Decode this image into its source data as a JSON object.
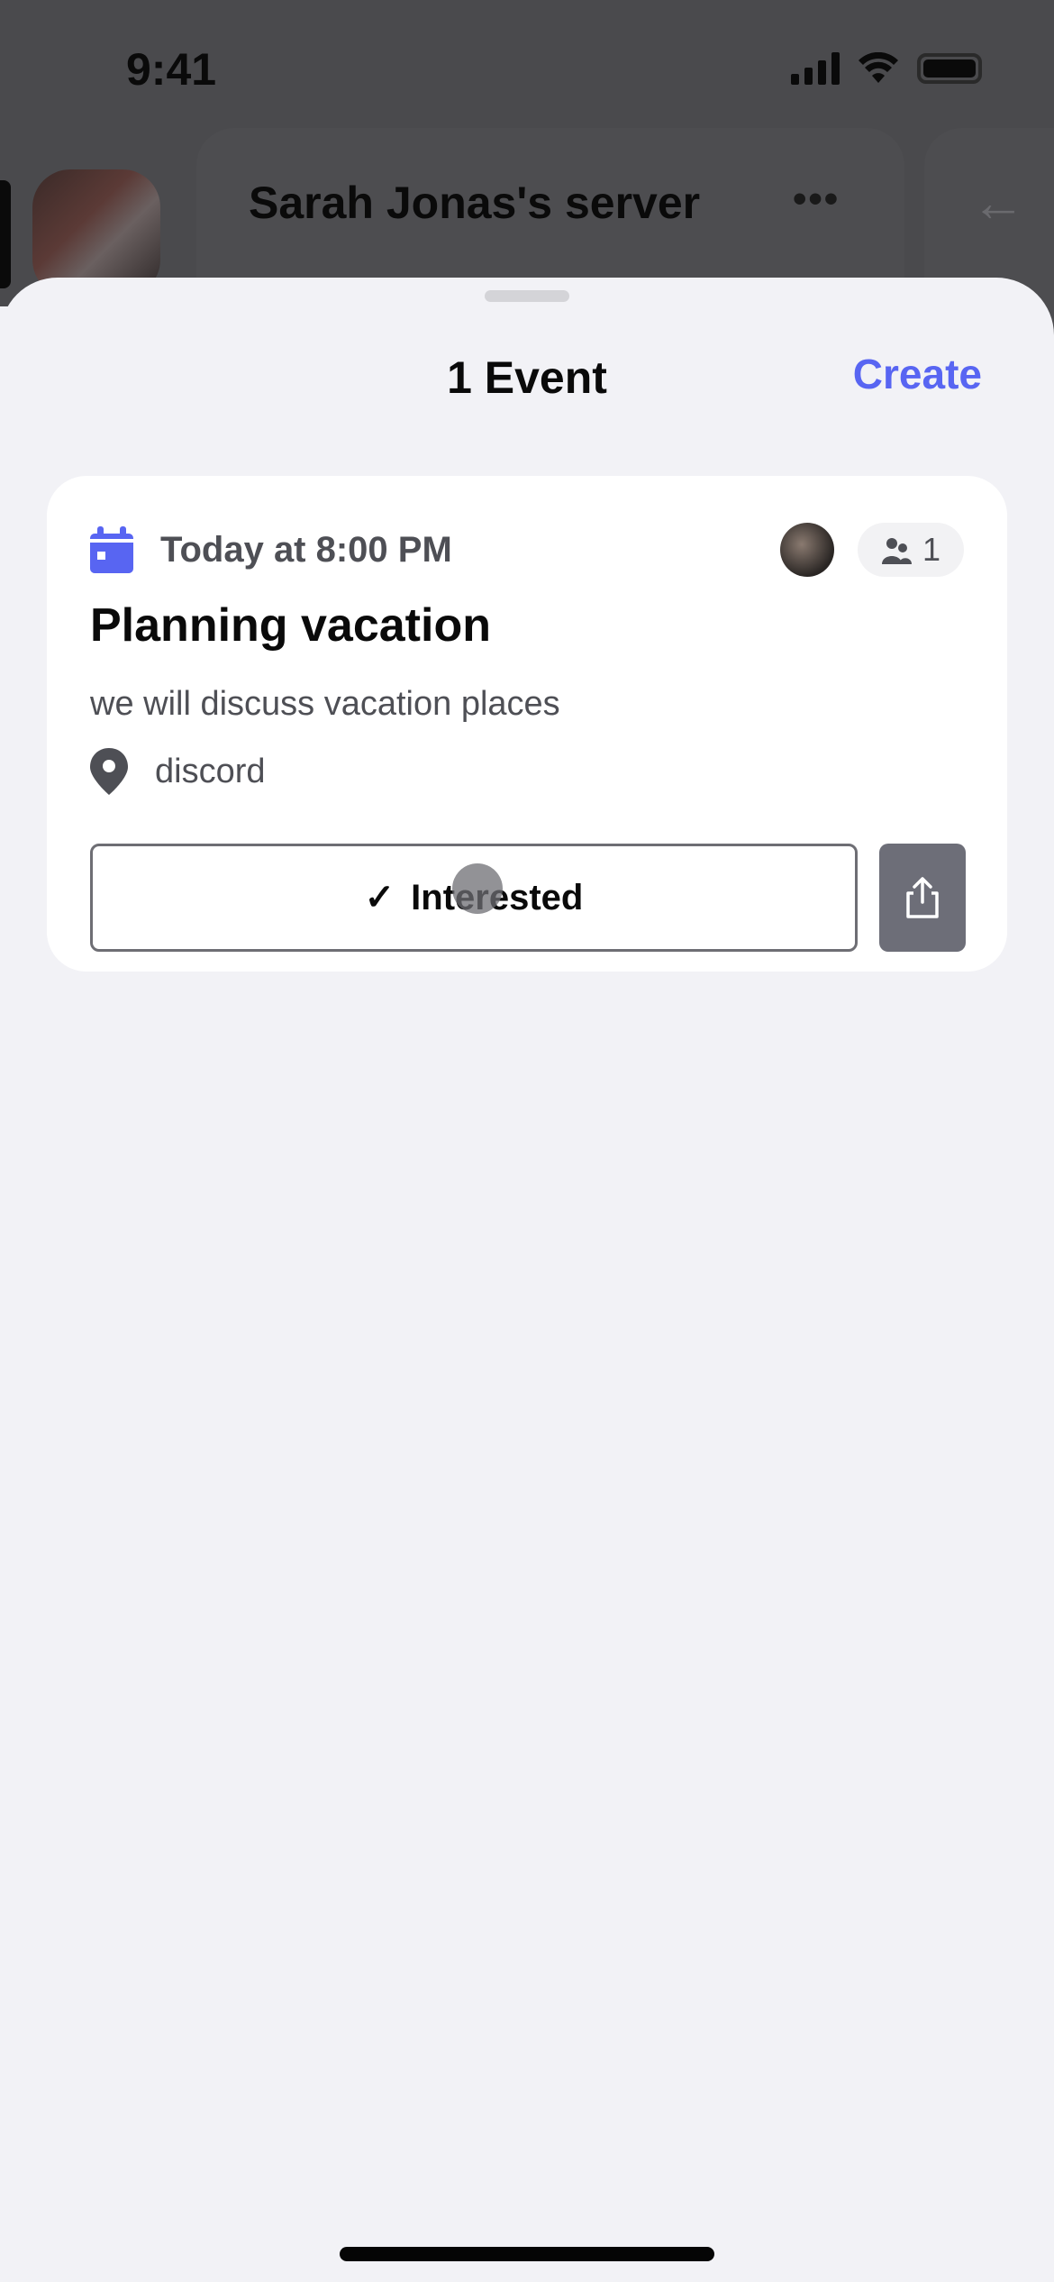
{
  "status_bar": {
    "time": "9:41",
    "icons": [
      "cellular-signal-icon",
      "wifi-icon",
      "battery-icon"
    ]
  },
  "background_screen": {
    "server_name": "Sarah Jonas's server",
    "more_icon": "•••",
    "back_icon": "←"
  },
  "sheet": {
    "title": "1 Event",
    "create_label": "Create",
    "accent_color": "#5865f2"
  },
  "events": [
    {
      "when": "Today at 8:00 PM",
      "interested_count": "1",
      "title": "Planning vacation",
      "description": "we will discuss vacation places",
      "location": "discord",
      "interested_label": "Interested",
      "interested_icon": "✓"
    }
  ]
}
